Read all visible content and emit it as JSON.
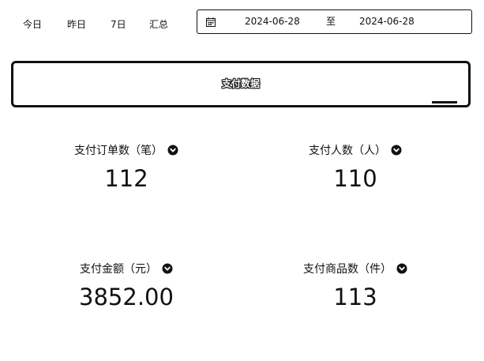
{
  "filters": {
    "quick_tabs": [
      {
        "label": "今日"
      },
      {
        "label": "昨日"
      },
      {
        "label": "7日"
      },
      {
        "label": "汇总"
      }
    ],
    "date_range": {
      "start": "2024-06-28",
      "separator": "至",
      "end": "2024-06-28",
      "icon": "calendar-icon"
    }
  },
  "section": {
    "title": "支付数据"
  },
  "metrics": [
    {
      "label": "支付订单数（笔）",
      "value": "112",
      "icon": "info-icon"
    },
    {
      "label": "支付人数（人）",
      "value": "110",
      "icon": "info-icon"
    },
    {
      "label": "支付金额（元）",
      "value": "3852.00",
      "icon": "info-icon"
    },
    {
      "label": "支付商品数（件）",
      "value": "113",
      "icon": "info-icon"
    }
  ],
  "colors": {
    "text": "#111111",
    "border": "#111111",
    "background": "#ffffff"
  }
}
